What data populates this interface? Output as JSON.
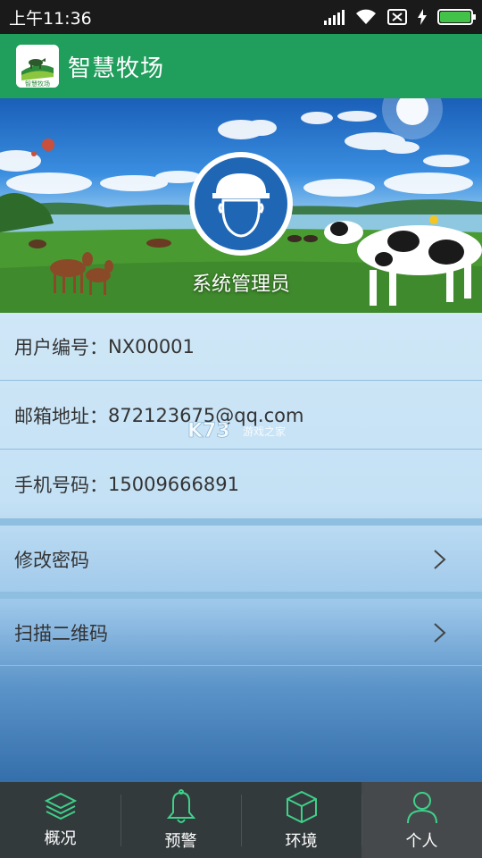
{
  "status_bar": {
    "time": "上午11:36",
    "battery_level": 1.0
  },
  "app": {
    "title": "智慧牧场",
    "logo_text": "智慧牧场"
  },
  "profile": {
    "role": "系统管理员"
  },
  "info_rows": [
    {
      "label": "用户编号：",
      "value": "NX00001"
    },
    {
      "label": "邮箱地址：",
      "value": "872123675@qq.com"
    },
    {
      "label": "手机号码：",
      "value": "15009666891"
    }
  ],
  "menu": [
    {
      "label": "修改密码"
    },
    {
      "label": "扫描二维码"
    }
  ],
  "watermark": {
    "brand": "K73",
    "sub": "游戏之家"
  },
  "bottom_nav": [
    {
      "label": "概况",
      "icon": "layers-icon",
      "active": false
    },
    {
      "label": "预警",
      "icon": "bell-icon",
      "active": false
    },
    {
      "label": "环境",
      "icon": "cube-icon",
      "active": false
    },
    {
      "label": "个人",
      "icon": "person-icon",
      "active": true
    }
  ],
  "colors": {
    "header_green": "#1f9e5c",
    "nav_icon_green": "#3fd08a",
    "avatar_blue": "#1f67b5"
  }
}
